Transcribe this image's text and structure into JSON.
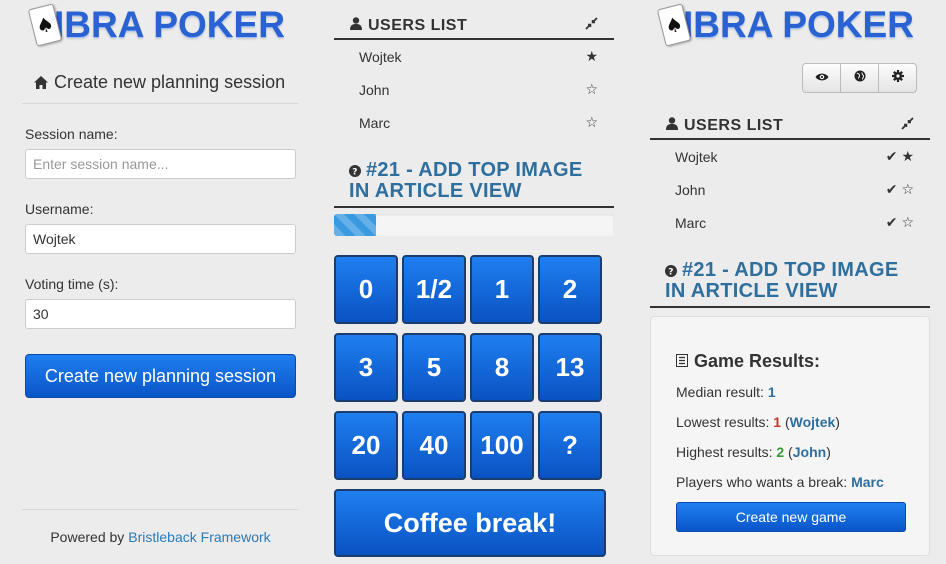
{
  "left": {
    "logo_text": "IBRA POKER",
    "title": "Create new planning session",
    "session_label": "Session name:",
    "session_placeholder": "Enter session name...",
    "session_value": "",
    "username_label": "Username:",
    "username_value": "Wojtek",
    "voting_label": "Voting time (s):",
    "voting_value": "30",
    "create_button": "Create new planning session",
    "footer_prefix": "Powered by",
    "footer_link": "Bristleback Framework"
  },
  "middle": {
    "users_header": "USERS LIST",
    "users": [
      {
        "name": "Wojtek",
        "star": "★"
      },
      {
        "name": "John",
        "star": "☆"
      },
      {
        "name": "Marc",
        "star": "☆"
      }
    ],
    "story_line1": "#21 - ADD TOP IMAGE",
    "story_line2": "IN ARTICLE VIEW",
    "progress_percent": 15,
    "cards": [
      "0",
      "1/2",
      "1",
      "2",
      "3",
      "5",
      "8",
      "13",
      "20",
      "40",
      "100",
      "?"
    ],
    "coffee_button": "Coffee break!"
  },
  "right": {
    "logo_text": "IBRA POKER",
    "toolbar_icons": [
      "eye-icon",
      "globe-icon",
      "gear-icon"
    ],
    "users_header": "USERS LIST",
    "users": [
      {
        "name": "Wojtek",
        "check": "✔",
        "star": "★"
      },
      {
        "name": "John",
        "check": "✔",
        "star": "☆"
      },
      {
        "name": "Marc",
        "check": "✔",
        "star": "☆"
      }
    ],
    "story_line1": "#21 - ADD TOP IMAGE",
    "story_line2": "IN ARTICLE VIEW",
    "results_title": "Game Results:",
    "median_label": "Median result:",
    "median_value": "1",
    "lowest_label": "Lowest results:",
    "lowest_value": "1",
    "lowest_user": "Wojtek",
    "highest_label": "Highest results:",
    "highest_value": "2",
    "highest_user": "John",
    "break_label": "Players who wants a break:",
    "break_user": "Marc",
    "new_game_button": "Create new game"
  },
  "colors": {
    "accent_blue": "#1f7ff0",
    "story_blue": "#2e6f9e",
    "lowest_red": "#c0392b",
    "highest_green": "#3a9a3a"
  }
}
